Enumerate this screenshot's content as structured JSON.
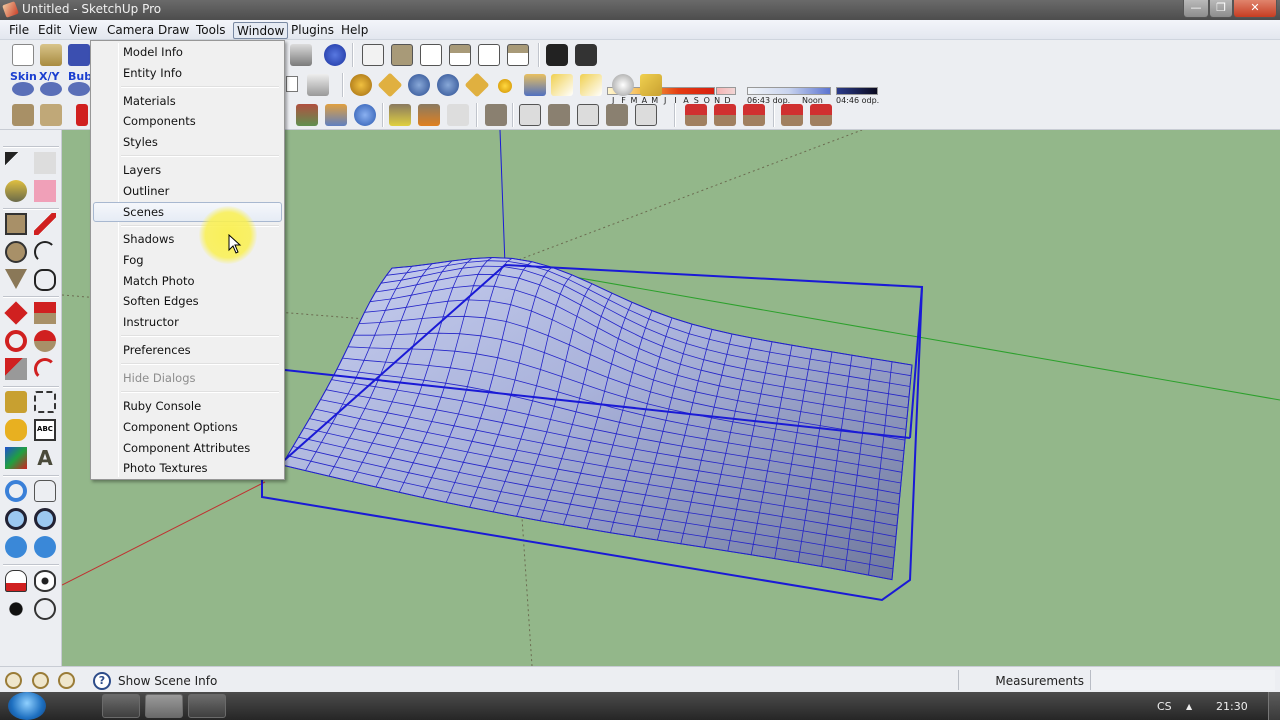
{
  "window": {
    "title": "Untitled - SketchUp Pro",
    "controls": {
      "minimize": "—",
      "maximize": "❐",
      "close": "✕"
    }
  },
  "menubar": {
    "items": [
      {
        "label": "File"
      },
      {
        "label": "Edit"
      },
      {
        "label": "View"
      },
      {
        "label": "Camera"
      },
      {
        "label": "Draw"
      },
      {
        "label": "Tools"
      },
      {
        "label": "Window"
      },
      {
        "label": "Plugins"
      },
      {
        "label": "Help"
      }
    ],
    "active": "Window"
  },
  "toolbars": {
    "row1_labels": [
      "new-file-icon",
      "open-file-icon",
      "save-icon",
      "print-icon",
      "model-info-icon",
      "iso-view-icon",
      "front-view-icon",
      "back-view-icon",
      "top-view-icon",
      "right-view-icon",
      "left-view-icon",
      "shadow-info-icon",
      "shadows-toggle-icon"
    ],
    "skin_labels": [
      "Skin",
      "X/Y",
      "Bub"
    ],
    "shadow_settings": {
      "months": [
        "J",
        "F",
        "M",
        "A",
        "M",
        "J",
        "J",
        "A",
        "S",
        "O",
        "N",
        "D"
      ],
      "time_start": "06:43 dop.",
      "time_mid": "Noon",
      "time_end": "04:46 odp."
    }
  },
  "window_menu": {
    "groups": [
      [
        {
          "label": "Model Info"
        },
        {
          "label": "Entity Info"
        }
      ],
      [
        {
          "label": "Materials"
        },
        {
          "label": "Components"
        },
        {
          "label": "Styles"
        }
      ],
      [
        {
          "label": "Layers"
        },
        {
          "label": "Outliner"
        },
        {
          "label": "Scenes",
          "highlighted": true
        }
      ],
      [
        {
          "label": "Shadows"
        },
        {
          "label": "Fog"
        },
        {
          "label": "Match Photo"
        },
        {
          "label": "Soften Edges"
        },
        {
          "label": "Instructor"
        }
      ],
      [
        {
          "label": "Preferences"
        }
      ],
      [
        {
          "label": "Hide Dialogs",
          "disabled": true
        }
      ],
      [
        {
          "label": "Ruby Console"
        },
        {
          "label": "Component Options"
        },
        {
          "label": "Component Attributes"
        },
        {
          "label": "Photo Textures"
        }
      ]
    ]
  },
  "statusbar": {
    "status_text": "Show Scene Info",
    "help_glyph": "?",
    "measurements_label": "Measurements",
    "measurements_value": ""
  },
  "taskbar": {
    "language": "CS",
    "tray_arrow": "▲",
    "clock": "21:30"
  },
  "colors": {
    "viewport_bg": "#93b78a",
    "model_edges": "#1a1ad6",
    "surface": "#9aa3c6"
  }
}
